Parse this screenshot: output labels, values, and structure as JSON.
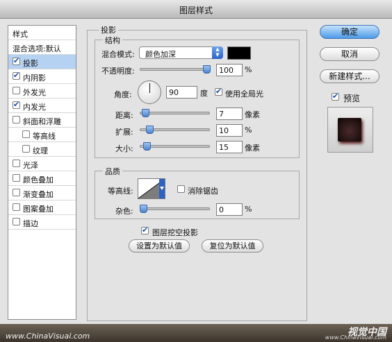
{
  "window": {
    "title": "图层样式"
  },
  "sidebar": {
    "header": "样式",
    "blend_options": "混合选项:默认",
    "items": [
      {
        "label": "投影",
        "checked": true,
        "selected": true
      },
      {
        "label": "内阴影",
        "checked": true
      },
      {
        "label": "外发光",
        "checked": false
      },
      {
        "label": "内发光",
        "checked": true
      },
      {
        "label": "斜面和浮雕",
        "checked": false
      },
      {
        "label": "等高线",
        "checked": false,
        "indent": true
      },
      {
        "label": "纹理",
        "checked": false,
        "indent": true
      },
      {
        "label": "光泽",
        "checked": false
      },
      {
        "label": "颜色叠加",
        "checked": false
      },
      {
        "label": "渐变叠加",
        "checked": false
      },
      {
        "label": "图案叠加",
        "checked": false
      },
      {
        "label": "描边",
        "checked": false
      }
    ]
  },
  "main": {
    "title": "投影",
    "structure": {
      "title": "结构",
      "blend_mode_label": "混合模式:",
      "blend_mode_value": "颜色加深",
      "blend_color": "#000000",
      "opacity_label": "不透明度:",
      "opacity_value": "100",
      "opacity_unit": "%",
      "opacity_level": 1.0,
      "angle_label": "角度:",
      "angle_value": "90",
      "angle_unit": "度",
      "global_light_label": "使用全局光",
      "global_light_checked": true,
      "distance_label": "距离:",
      "distance_value": "7",
      "distance_unit": "像素",
      "distance_level": 0.03,
      "spread_label": "扩展:",
      "spread_value": "10",
      "spread_unit": "%",
      "spread_level": 0.1,
      "size_label": "大小:",
      "size_value": "15",
      "size_unit": "像素",
      "size_level": 0.06
    },
    "quality": {
      "title": "品质",
      "contour_label": "等高线:",
      "antialias_label": "消除锯齿",
      "antialias_checked": false,
      "noise_label": "杂色:",
      "noise_value": "0",
      "noise_unit": "%",
      "noise_level": 0.0
    },
    "knockout_label": "图层挖空投影",
    "knockout_checked": true,
    "set_default_label": "设置为默认值",
    "reset_default_label": "复位为默认值"
  },
  "buttons": {
    "ok": "确定",
    "cancel": "取消",
    "new_style": "新建样式...",
    "preview_label": "预览",
    "preview_checked": true
  },
  "watermark": {
    "left": "www.ChinaVisual.com",
    "right": "视觉中国",
    "right_url": "www.ChinaVisual.com"
  }
}
